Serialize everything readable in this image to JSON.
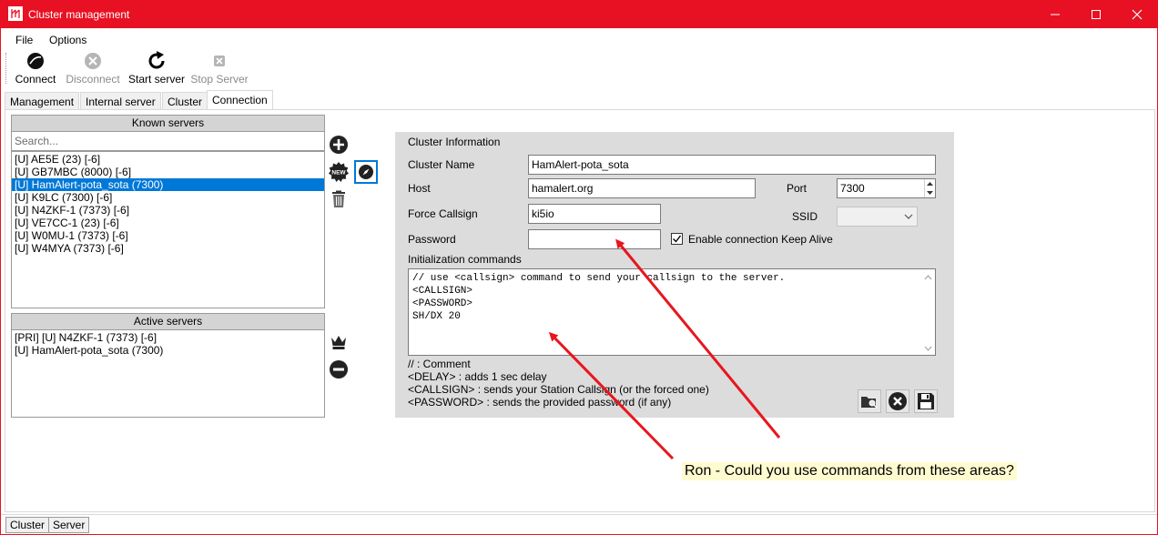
{
  "window": {
    "title": "Cluster management",
    "controls": [
      "minimize",
      "maximize",
      "close"
    ]
  },
  "menu": [
    "File",
    "Options"
  ],
  "toolbar": {
    "connect": "Connect",
    "disconnect": "Disconnect",
    "start_server": "Start server",
    "stop_server": "Stop Server"
  },
  "tabs": [
    "Management",
    "Internal server",
    "Cluster",
    "Connection"
  ],
  "active_tab": "Connection",
  "known_servers": {
    "header": "Known servers",
    "search_placeholder": "Search...",
    "items": [
      "[U] AE5E (23) [-6]",
      "[U] GB7MBC (8000) [-6]",
      "[U] HamAlert-pota_sota (7300)",
      "[U] K9LC (7300) [-6]",
      "[U] N4ZKF-1 (7373) [-6]",
      "[U] VE7CC-1 (23) [-6]",
      "[U] W0MU-1 (7373) [-6]",
      "[U] W4MYA (7373) [-6]"
    ],
    "selected": "[U] HamAlert-pota_sota (7300)"
  },
  "active_servers": {
    "header": "Active servers",
    "items": [
      "[PRI] [U] N4ZKF-1 (7373) [-6]",
      "[U] HamAlert-pota_sota (7300)"
    ]
  },
  "cluster_info": {
    "group_title": "Cluster Information",
    "name_label": "Cluster Name",
    "name_value": "HamAlert-pota_sota",
    "host_label": "Host",
    "host_value": "hamalert.org",
    "port_label": "Port",
    "port_value": "7300",
    "force_callsign_label": "Force Callsign",
    "force_callsign_value": "ki5io",
    "ssid_label": "SSID",
    "ssid_value": "",
    "password_label": "Password",
    "keepalive_label": "Enable connection Keep Alive",
    "keepalive_checked": true,
    "init_label": "Initialization commands",
    "init_lines": [
      "// use <callsign> command to send your callsign to the server.",
      "<CALLSIGN>",
      "<PASSWORD>",
      "SH/DX 20"
    ],
    "help_lines": [
      "// : Comment",
      "<DELAY> : adds 1 sec delay",
      "<CALLSIGN> : sends your Station Callsign (or the forced one)",
      "<PASSWORD> : sends the provided password (if any)"
    ]
  },
  "annotation": {
    "text": "Ron - Could you use commands from these areas?",
    "arrow_color": "#e8161e"
  },
  "status_tabs": [
    "Cluster",
    "Server"
  ],
  "colors": {
    "title_bar": "#e81123",
    "selection": "#0078d7",
    "group_bg": "#dcdcdc"
  }
}
